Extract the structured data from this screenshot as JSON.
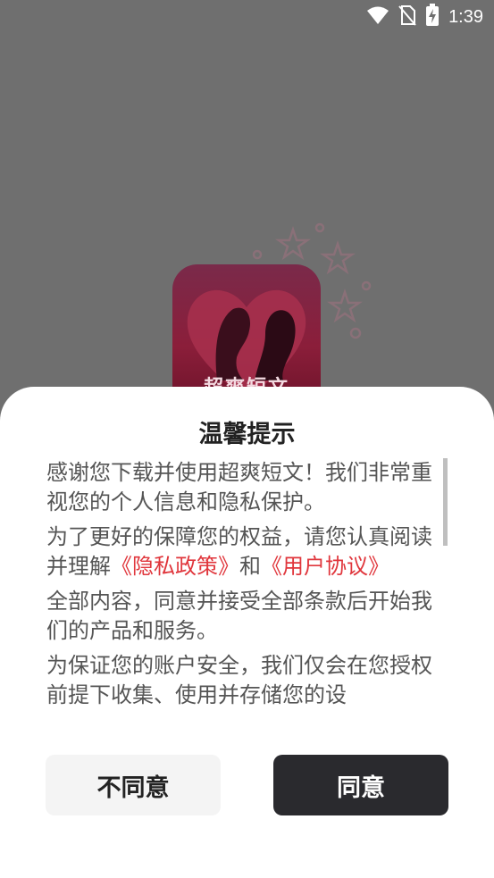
{
  "status_bar": {
    "time": "1:39",
    "icons": [
      "wifi-icon",
      "no-sim-icon",
      "battery-charging-icon"
    ]
  },
  "splash": {
    "app_name": "超爽短文"
  },
  "dialog": {
    "title": "温馨提示",
    "paragraphs": {
      "p1": "感谢您下载并使用超爽短文！我们非常重视您的个人信息和隐私保护。",
      "p2_prefix": "为了更好的保障您的权益，请您认真阅读并理解",
      "p2_link_privacy": "《隐私政策》",
      "p2_and": "和",
      "p2_link_agreement": "《用户协议》",
      "p3": "全部内容，同意并接受全部条款后开始我们的产品和服务。",
      "p4": "为保证您的账户安全，我们仅会在您授权前提下收集、使用并存储您的设"
    },
    "buttons": {
      "disagree": "不同意",
      "agree": "同意"
    },
    "colors": {
      "link": "#e0363c",
      "agree_bg": "#2a2a2e"
    }
  }
}
